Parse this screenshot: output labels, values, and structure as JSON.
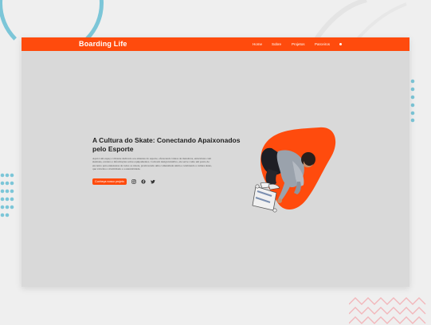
{
  "navbar": {
    "brand": "Boarding Life",
    "links": [
      {
        "label": "Home"
      },
      {
        "label": "Sobre"
      },
      {
        "label": "Projetos"
      },
      {
        "label": "Parceiros"
      }
    ]
  },
  "hero": {
    "title": "A Cultura do Skate: Conectando Apaixonados pelo Esporte",
    "body": "Aqui é um espaço vibrante dedicado aos amantes do esporte, oferecendo vídeos de manobras, entrevistas com skatistas, eventos e informações sobre equipamentos. Com um design intuitivo, ele serve como um ponto de encontro para entusiastas de todos os níveis, promovendo uma comunidade unida e celebrando a cultura skate, que valoriza a criatividade e a autenticidade.",
    "cta_label": "Conheça nosso projeto",
    "social_icons": [
      "instagram-icon",
      "facebook-icon",
      "twitter-icon"
    ]
  },
  "colors": {
    "accent": "#ff4b0d",
    "content_bg": "#d9d9d9",
    "title_text": "#222222"
  }
}
